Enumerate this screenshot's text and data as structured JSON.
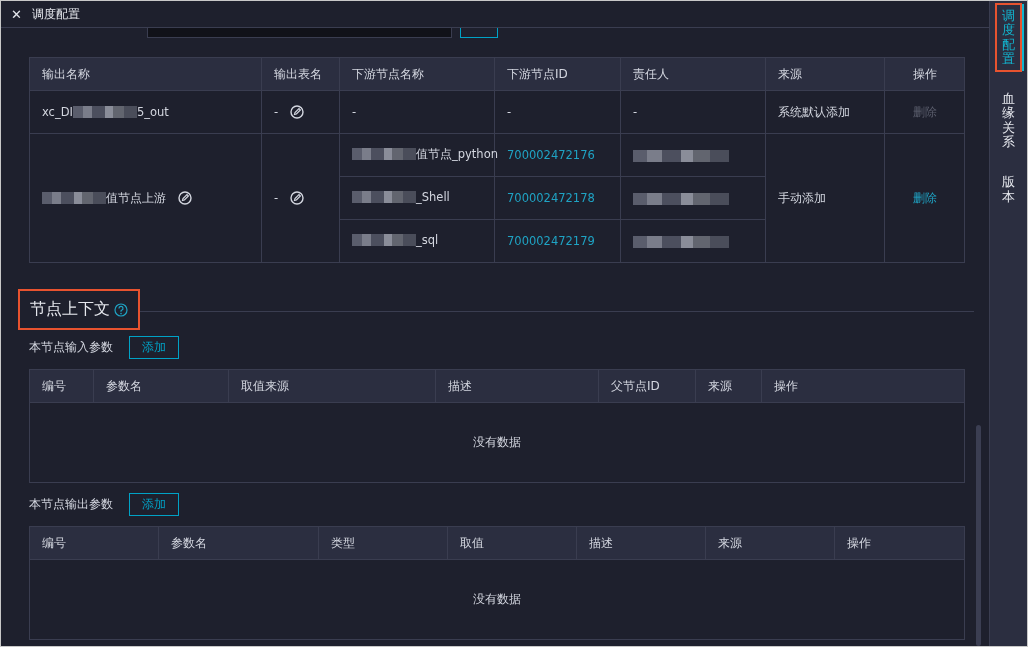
{
  "window": {
    "title": "调度配置",
    "close": "✕"
  },
  "output_table": {
    "columns": [
      "输出名称",
      "输出表名",
      "下游节点名称",
      "下游节点ID",
      "责任人",
      "来源",
      "操作"
    ],
    "rows": [
      {
        "output_name": [
          {
            "kind": "text",
            "text": "xc_DI"
          },
          {
            "kind": "masked"
          },
          {
            "kind": "text",
            "text": "5_out"
          }
        ],
        "output_table": "-",
        "downstream": [
          {
            "name": [
              {
                "kind": "text",
                "text": "-"
              }
            ],
            "id": "-",
            "owner": [
              {
                "kind": "text",
                "text": "-"
              }
            ]
          }
        ],
        "source": "系统默认添加",
        "action": "删除",
        "disabled": true
      },
      {
        "output_name": [
          {
            "kind": "masked"
          },
          {
            "kind": "text",
            "text": "值节点上游"
          }
        ],
        "output_table": "-",
        "downstream": [
          {
            "name": [
              {
                "kind": "masked"
              },
              {
                "kind": "text",
                "text": "值节点_python"
              }
            ],
            "id": "700002472176",
            "owner": [
              {
                "kind": "masked"
              }
            ]
          },
          {
            "name": [
              {
                "kind": "masked"
              },
              {
                "kind": "text",
                "text": "_Shell"
              }
            ],
            "id": "700002472178",
            "owner": [
              {
                "kind": "masked"
              }
            ]
          },
          {
            "name": [
              {
                "kind": "masked"
              },
              {
                "kind": "text",
                "text": "_sql"
              }
            ],
            "id": "700002472179",
            "owner": [
              {
                "kind": "masked"
              }
            ]
          }
        ],
        "source": "手动添加",
        "action": "删除",
        "disabled": false
      }
    ]
  },
  "context": {
    "title": "节点上下文",
    "highlighted": true,
    "sections": [
      {
        "label": "本节点输入参数",
        "button": "添加",
        "columns": [
          "编号",
          "参数名",
          "取值来源",
          "描述",
          "父节点ID",
          "来源",
          "操作"
        ],
        "empty": "没有数据"
      },
      {
        "label": "本节点输出参数",
        "button": "添加",
        "columns": [
          "编号",
          "参数名",
          "类型",
          "取值",
          "描述",
          "来源",
          "操作"
        ],
        "empty": "没有数据"
      }
    ]
  },
  "sidebar": {
    "tabs": [
      {
        "label": "调度配置",
        "selected": true,
        "highlighted": true
      },
      {
        "label": "血缘关系",
        "selected": false,
        "highlighted": false
      },
      {
        "label": "版本",
        "selected": false,
        "highlighted": false
      }
    ]
  }
}
